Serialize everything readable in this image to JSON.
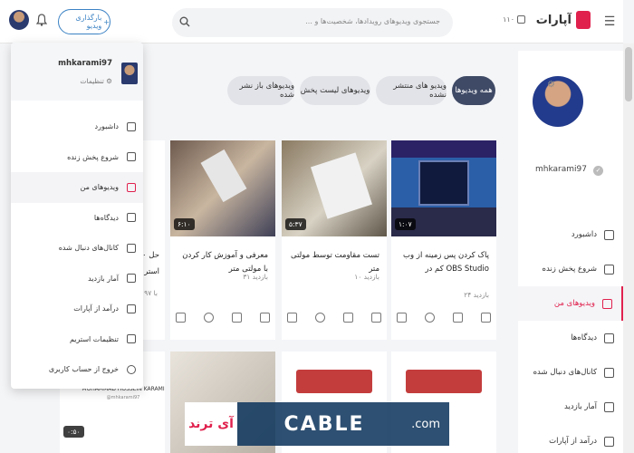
{
  "header": {
    "logo": "آپارات",
    "live_count": "۱۱۰",
    "search_placeholder": "جستجوی ویدیوهای رویدادها، شخصیت‌ها و ...",
    "upload_label": "بارگذاری ویدیو",
    "upload_plus": "+"
  },
  "profile": {
    "name": "mhkarami97"
  },
  "sidebar": {
    "items": [
      {
        "label": "داشبورد",
        "active": false
      },
      {
        "label": "شروع پخش زنده",
        "active": false
      },
      {
        "label": "ویدیوهای من",
        "active": true
      },
      {
        "label": "دیدگاه‌ها",
        "active": false
      },
      {
        "label": "کانال‌های دنبال شده",
        "active": false
      },
      {
        "label": "آمار بازدید",
        "active": false
      },
      {
        "label": "درآمد از آپارات",
        "active": false
      }
    ]
  },
  "tabs": [
    {
      "label": "همه ویدیوها",
      "active": true
    },
    {
      "label": "ویدیو های منتشر نشده",
      "active": false
    },
    {
      "label": "ویدیوهای لیست پخش",
      "active": false
    },
    {
      "label": "ویدیوهای باز نشر شده",
      "active": false
    }
  ],
  "cards": [
    {
      "title": "پاک کردن پس زمینه از وب کم در OBS Studio",
      "views": "۲۴ بازدید",
      "duration": "۱:۰۷"
    },
    {
      "title": "تست مقاومت توسط مولتی متر",
      "views": "۱۰ بازدید",
      "duration": "۵:۳۷"
    },
    {
      "title": "معرفی و آموزش کار کردن با مولتی متر",
      "views": "۳۱ بازدید",
      "duration": "۶:۱۰"
    }
  ],
  "partial_card": {
    "title_line1": "حل ۰",
    "title_line2": "استر",
    "views": "۹۷ با"
  },
  "dropdown": {
    "name": "mhkarami97",
    "settings_label": "تنظیمات",
    "items": [
      {
        "label": "داشبورد",
        "active": false
      },
      {
        "label": "شروع پخش زنده",
        "active": false
      },
      {
        "label": "ویدیوهای من",
        "active": true
      },
      {
        "label": "دیدگاه‌ها",
        "active": false
      },
      {
        "label": "کانال‌های دنبال شده",
        "active": false
      },
      {
        "label": "آمار بازدید",
        "active": false
      },
      {
        "label": "درآمد از آپارات",
        "active": false
      },
      {
        "label": "تنظیمات استریم",
        "active": false
      },
      {
        "label": "خروج از حساب کاربری",
        "active": false
      }
    ]
  },
  "row2": {
    "card_name_line1": "MOHAMMAD HOSSEIN KARAMI",
    "card_name_line2": "@mhkarami97",
    "duration": "۰:۵۰"
  },
  "watermark": {
    "left": "آی ترند",
    "mid": "CABLE",
    "right": ".com"
  },
  "colors": {
    "accent": "#e0214d",
    "tab_active": "#3f4a66",
    "upload_border": "#3b82c4"
  }
}
